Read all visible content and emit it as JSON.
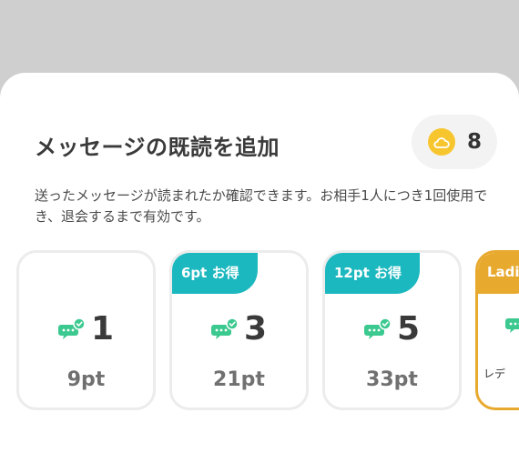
{
  "modal": {
    "title": "メッセージの既読を追加",
    "balance": "8",
    "description": "送ったメッセージが読まれたか確認できます。お相手1人につき1回使用でき、退会するまで有効です。"
  },
  "plans": [
    {
      "count": "1",
      "price": "9pt",
      "badge": ""
    },
    {
      "count": "3",
      "price": "21pt",
      "badge": "6pt お得"
    },
    {
      "count": "5",
      "price": "33pt",
      "badge": "12pt お得"
    },
    {
      "badge": "Ladi",
      "sub_label": "レデ"
    }
  ],
  "colors": {
    "teal_badge": "#1cb8bf",
    "gold_badge": "#e8a92f",
    "coin": "#f7c62f",
    "message_icon": "#3cc98f"
  },
  "icons": {
    "balance": "coin-cloud-icon",
    "plan": "message-read-icon"
  }
}
